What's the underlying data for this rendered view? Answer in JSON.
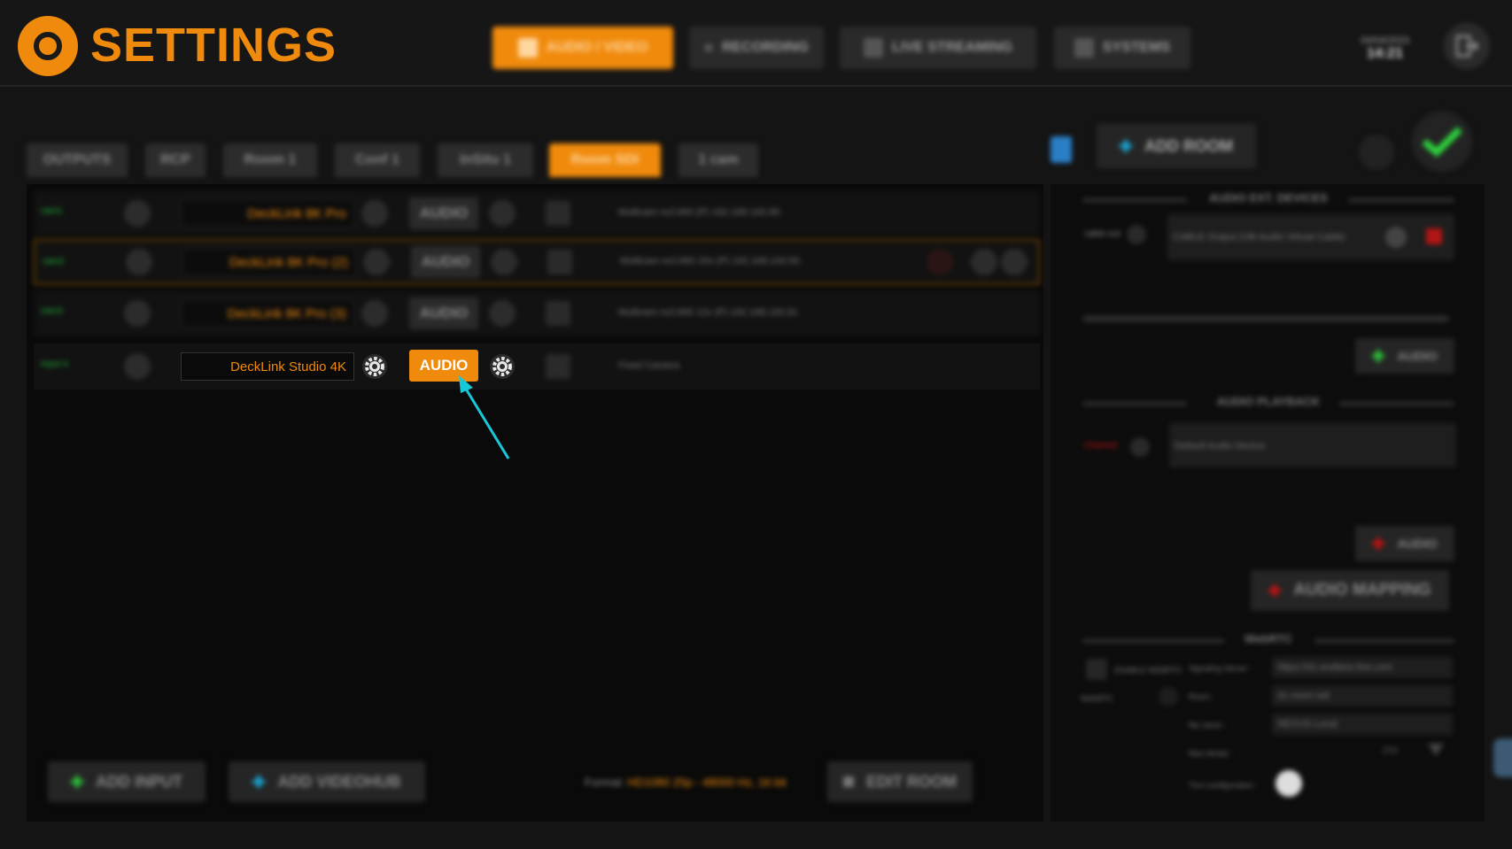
{
  "header": {
    "title": "SETTINGS",
    "nav": [
      {
        "label": "AUDIO / VIDEO",
        "icon": "audio-video-icon",
        "active": true
      },
      {
        "label": "RECORDING",
        "icon": "record-dot-icon",
        "active": false
      },
      {
        "label": "LIVE STREAMING",
        "icon": "antenna-icon",
        "active": false
      },
      {
        "label": "SYSTEMS",
        "icon": "antenna-icon",
        "active": false
      }
    ],
    "date": "04/04/2023",
    "time": "14:21"
  },
  "tabs": [
    {
      "label": "OUTPUTS",
      "active": false
    },
    {
      "label": "RCP",
      "active": false
    },
    {
      "label": "Room 1",
      "active": false
    },
    {
      "label": "Conf 1",
      "active": false
    },
    {
      "label": "InSitu 1",
      "active": false
    },
    {
      "label": "Room SDI",
      "active": true
    },
    {
      "label": "1 cam",
      "active": false
    }
  ],
  "top_actions": {
    "add_room": "ADD ROOM"
  },
  "inputs": [
    {
      "name": "cam1",
      "device": "DeckLink 8K Pro",
      "audio": "AUDIO",
      "info": "Multicam ncC460 (P) 192.168.100.89"
    },
    {
      "name": "cam2",
      "device": "DeckLink 8K Pro (2)",
      "audio": "AUDIO",
      "info": "Multicam ncC460 20x (P) 192.168.100.90"
    },
    {
      "name": "cam3",
      "device": "DeckLink 8K Pro (3)",
      "audio": "AUDIO",
      "info": "Multicam ncC460 12x (P) 192.168.100.91"
    },
    {
      "name": "Input 4",
      "device": "DeckLink Studio 4K",
      "audio": "AUDIO",
      "info": "Fixed Camera"
    }
  ],
  "bottom": {
    "add_input": "ADD INPUT",
    "add_videohub": "ADD VIDEOHUB",
    "format_label": "Format:",
    "format_value": "HD1080 25p - 48000 Hz, 16 bit",
    "edit_room": "EDIT ROOM"
  },
  "right": {
    "audio_ext_title": "AUDIO EXT. DEVICES",
    "ext_device_name": "cable-out",
    "ext_device_value": "CABLE Output (VB-Audio Virtual Cable)",
    "add_audio_1": "AUDIO",
    "playback_title": "AUDIO PLAYBACK",
    "playback_name": "Channel",
    "playback_value": "Default Audio Device",
    "add_audio_2": "AUDIO",
    "audio_mapping": "AUDIO MAPPING",
    "webrtc_title": "WebRTC",
    "enable_webrtc": "ENABLE WEBRTC",
    "mode_label": "WebRTC",
    "signaling_label": "Signaling Server :",
    "signaling_value": "https://rtc.endless-live.com",
    "room_label": "Room :",
    "room_value": "rtc-room-sdi",
    "name_label": "My name :",
    "name_value": "NEXUS-Local",
    "max_label": "Max bitrate :",
    "max_value": "256",
    "turn_label": "Turn configuration :"
  },
  "colors": {
    "accent": "#f08a0c",
    "green": "#1dbf3c",
    "arrow": "#19c8d8",
    "background": "#000000"
  }
}
